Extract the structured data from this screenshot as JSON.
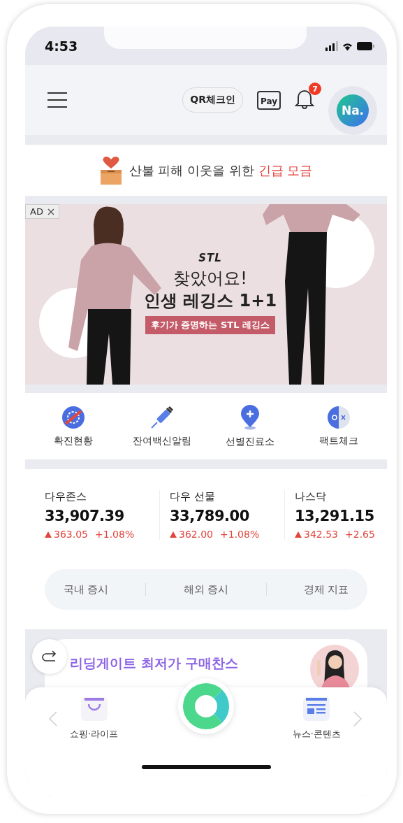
{
  "status_bar": {
    "time": "4:53"
  },
  "header": {
    "qr_button": "QR체크인",
    "pay_label": "Pay",
    "notification_count": "7",
    "avatar": "Na."
  },
  "donation": {
    "text": "산불 피해 이웃을 위한",
    "highlight": "긴급 모금"
  },
  "ad": {
    "badge": "AD",
    "brand": "STL",
    "headline": "찾았어요!",
    "headline_2": "인생 레깅스 1+1",
    "tag": "후기가 증명하는 STL 레깅스"
  },
  "shortcuts": [
    {
      "kind": "virus",
      "label": "확진현황"
    },
    {
      "kind": "syringe",
      "label": "잔여백신알림"
    },
    {
      "kind": "pin",
      "label": "선별진료소"
    },
    {
      "kind": "factcheck",
      "label": "팩트체크"
    }
  ],
  "stocks": [
    {
      "name": "다우존스",
      "value": "33,907.39",
      "change": "363.05",
      "percent": "+1.08%",
      "rising": true
    },
    {
      "name": "다우 선물",
      "value": "33,789.00",
      "change": "362.00",
      "percent": "+1.08%",
      "rising": true
    },
    {
      "name": "나스닥",
      "value": "13,291.15",
      "change": "342.53",
      "percent": "+2.65",
      "rising": true
    }
  ],
  "market_tabs": [
    "국내 증시",
    "해외 증시",
    "경제 지표"
  ],
  "promo": {
    "title": "리딩게이트 최저가 구매찬스"
  },
  "bottom_nav": {
    "left": "쇼핑·라이프",
    "right": "뉴스·콘텐츠"
  }
}
